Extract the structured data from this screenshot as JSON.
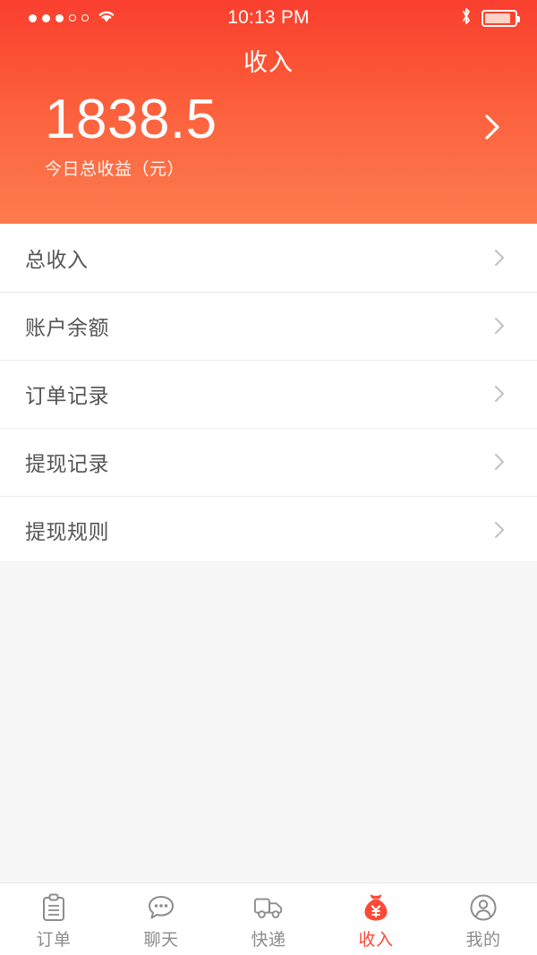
{
  "statusbar": {
    "signal_dots_filled": 3,
    "signal_dots_empty": 2,
    "wifi_icon": "wifi-icon",
    "time": "10:13 PM",
    "bluetooth_icon": "bluetooth-icon",
    "battery_icon": "battery-icon",
    "battery_percent": 78
  },
  "header": {
    "title": "收入",
    "amount": "1838.5",
    "amount_label": "今日总收益（元）",
    "arrow_icon": "chevron-right-icon",
    "gradient_start": "#fa3f2f",
    "gradient_end": "#fd7c4e"
  },
  "list": {
    "rows": [
      {
        "label": "总收入",
        "arrow_icon": "chevron-right-icon"
      },
      {
        "label": "账户余额",
        "arrow_icon": "chevron-right-icon"
      },
      {
        "label": "订单记录",
        "arrow_icon": "chevron-right-icon"
      },
      {
        "label": "提现记录",
        "arrow_icon": "chevron-right-icon"
      },
      {
        "label": "提现规则",
        "arrow_icon": "chevron-right-icon"
      }
    ]
  },
  "tabbar": {
    "active_color": "#fb4a36",
    "inactive_color": "#8c8c8c",
    "tabs": [
      {
        "label": "订单",
        "icon": "clipboard-icon",
        "active": false
      },
      {
        "label": "聊天",
        "icon": "chat-bubble-icon",
        "active": false
      },
      {
        "label": "快递",
        "icon": "truck-icon",
        "active": false
      },
      {
        "label": "收入",
        "icon": "money-bag-icon",
        "active": true
      },
      {
        "label": "我的",
        "icon": "person-circle-icon",
        "active": false
      }
    ]
  }
}
